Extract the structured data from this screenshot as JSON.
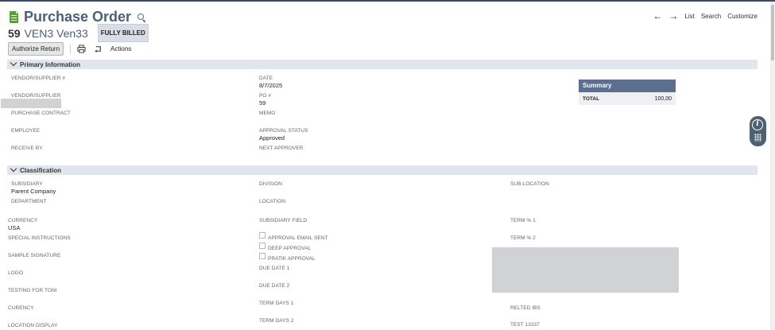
{
  "page": {
    "title": "Purchase Order",
    "record_number": "59",
    "record_name": "VEN3 Ven33",
    "status": "FULLY BILLED"
  },
  "nav": {
    "back_icon": "arrow-left-icon",
    "forward_icon": "arrow-right-icon",
    "list": "List",
    "search": "Search",
    "customize": "Customize"
  },
  "toolbar": {
    "authorize_return": "Authorize Return",
    "print_icon": "printer-icon",
    "refresh_icon": "refresh-icon",
    "actions": "Actions"
  },
  "primary": {
    "section_title": "Primary Information",
    "vendor_supplier_num_label": "VENDOR/SUPPLIER #",
    "vendor_supplier_label": "VENDOR/SUPPLIER",
    "purchase_contract_label": "PURCHASE CONTRACT",
    "employee_label": "EMPLOYEE",
    "receive_by_label": "RECEIVE BY",
    "date_label": "DATE",
    "date_value": "8/7/2025",
    "po_label": "PO #",
    "po_value": "59",
    "memo_label": "MEMO",
    "approval_status_label": "APPROVAL STATUS",
    "approval_status_value": "Approved",
    "next_approver_label": "NEXT APPROVER"
  },
  "summary": {
    "title": "Summary",
    "total_label": "TOTAL",
    "total_value": "100,00"
  },
  "classification": {
    "section_title": "Classification",
    "subsidiary_label": "SUBSIDIARY",
    "subsidiary_value": "Parent Company",
    "department_label": "DEPARTMENT",
    "currency_label": "CURRENCY",
    "currency_value": "USA",
    "special_instructions_label": "SPECIAL INSTRUCTIONS",
    "sample_signature_label": "SAMPLE SIGNATURE",
    "logo_label": "LOGO",
    "testing_for_toni_label": "TESTING FOR TONI",
    "curency_label": "CURENCY",
    "location_display_label": "LOCATION DISPLAY",
    "division_label": "DIVISION",
    "location_label": "LOCATION",
    "subsidiary_field_label": "SUBSIDIARY FIELD",
    "approval_email_sent_label": "APPROVAL EMAIL SENT",
    "deep_approval_label": "DEEP APPROVAL",
    "pratik_approval_label": "PRATIK APPROVAL",
    "due_date_1_label": "DUE DATE 1",
    "due_date_2_label": "DUE DATE 2",
    "term_days_1_label": "TERM DAYS 1",
    "term_days_2_label": "TERM DAYS 2",
    "sub_location_label": "SUB-LOCATION",
    "term_pct_1_label": "TERM % 1",
    "term_pct_2_label": "TERM % 2",
    "relted_ibs_label": "RELTED IBS",
    "test_13337_label": "TEST 13337"
  },
  "side_widget": {
    "info_icon": "info-icon",
    "grid_icon": "keypad-icon"
  },
  "colors": {
    "title": "#4d5f79",
    "section_bar": "#e1e6ee",
    "summary_header": "#5c6f8e",
    "icon_green": "#5a9e3c",
    "widget": "#4d6172"
  }
}
